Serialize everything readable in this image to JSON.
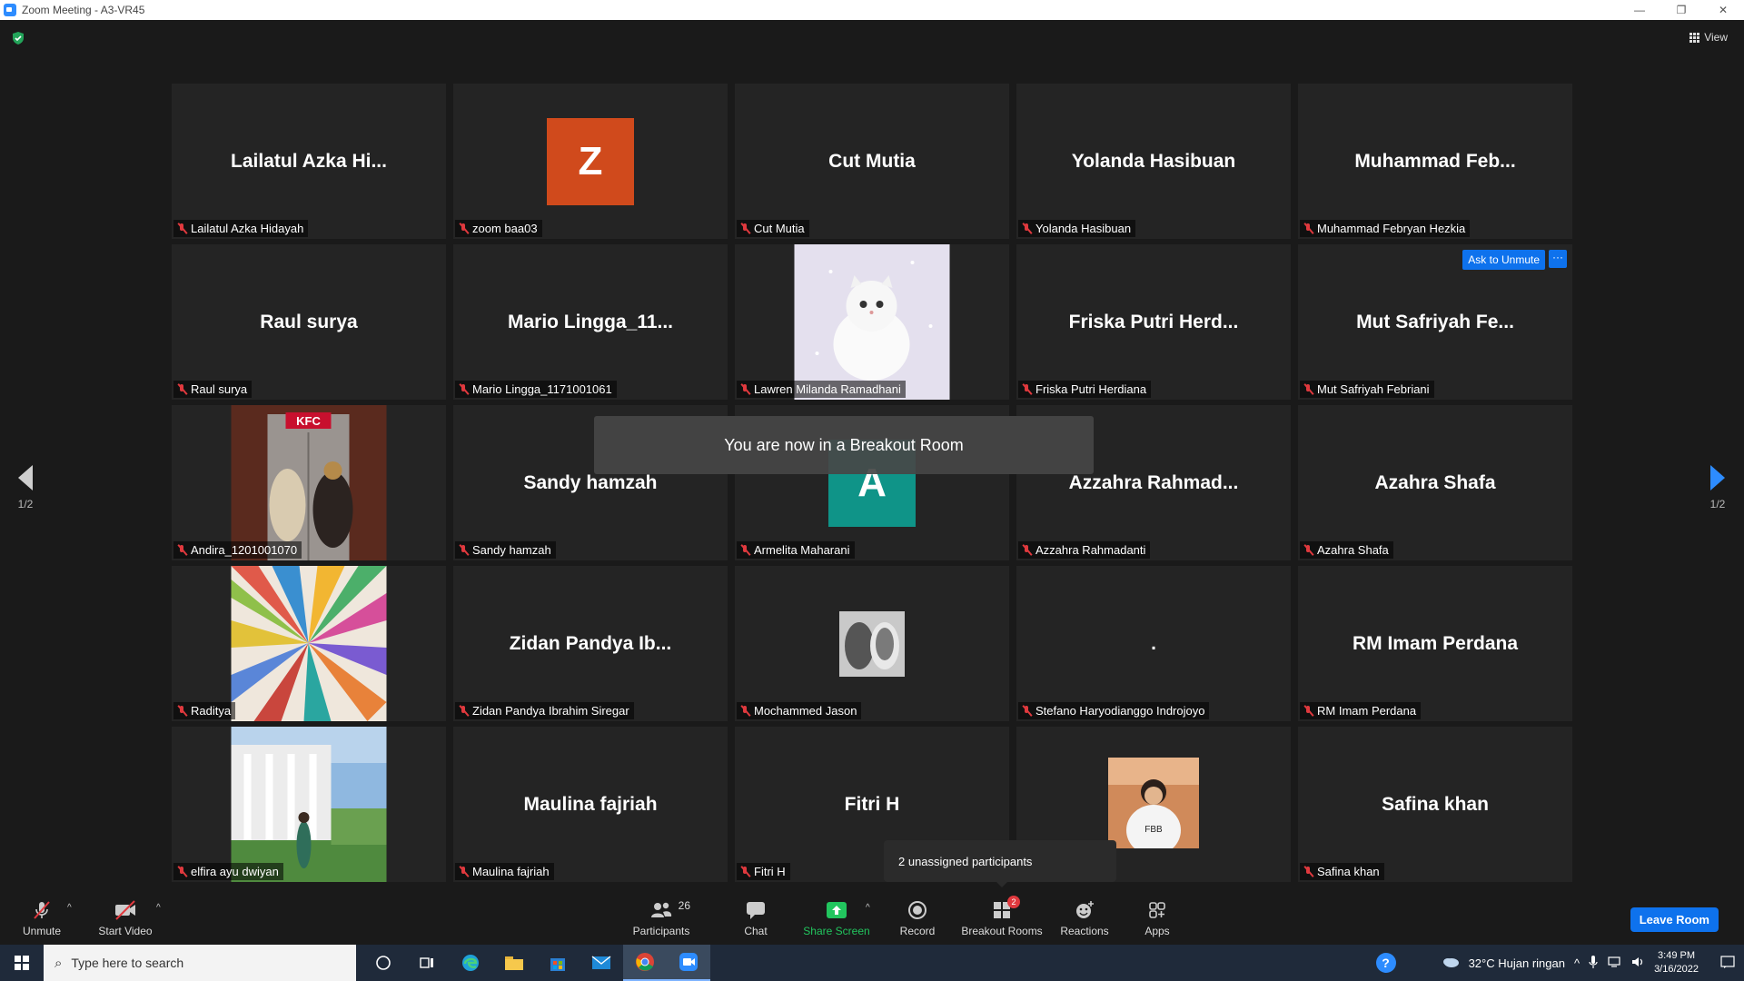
{
  "window": {
    "title": "Zoom Meeting - A3-VR45"
  },
  "header": {
    "view_label": "View"
  },
  "tiles": [
    {
      "name": "Lailatul Azka Hidayah",
      "display": "Lailatul Azka Hi..."
    },
    {
      "name": "zoom baa03",
      "avatar_letter": "Z",
      "avatar_color": "#d04a1c"
    },
    {
      "name": "Cut Mutia",
      "display": "Cut Mutia"
    },
    {
      "name": "Yolanda Hasibuan",
      "display": "Yolanda Hasibuan"
    },
    {
      "name": "Muhammad Febryan Hezkia",
      "display": "Muhammad  Feb..."
    },
    {
      "name": "Raul surya",
      "display": "Raul surya"
    },
    {
      "name": "Mario Lingga_1171001061",
      "display": "Mario  Lingga_11..."
    },
    {
      "name": "Lawren Milanda Ramadhani",
      "photo": "white-cat"
    },
    {
      "name": "Friska Putri Herdiana",
      "display": "Friska Putri Herd..."
    },
    {
      "name": "Mut Safriyah Febriani",
      "display": "Mut Safriyah Fe..."
    },
    {
      "name": "Andira_1201001070",
      "photo": "kfc-elevator"
    },
    {
      "name": "Sandy hamzah",
      "display": "Sandy hamzah"
    },
    {
      "name": "Armelita Maharani",
      "avatar_letter": "A",
      "avatar_color": "#0f9488"
    },
    {
      "name": "Azzahra Rahmadanti",
      "display": "Azzahra  Rahmad..."
    },
    {
      "name": "Azahra Shafa",
      "display": "Azahra Shafa"
    },
    {
      "name": "Raditya",
      "photo": "colorful-rays"
    },
    {
      "name": "Zidan Pandya Ibrahim Siregar",
      "display": "Zidan Pandya Ib..."
    },
    {
      "name": "Mochammed Jason",
      "photo": "small-cars"
    },
    {
      "name": "Stefano Haryodianggo Indrojoyo",
      "display": "."
    },
    {
      "name": "RM Imam Perdana",
      "display": "RM Imam Perdana"
    },
    {
      "name": "elfira ayu dwiyan",
      "photo": "palace-garden"
    },
    {
      "name": "Maulina fajriah",
      "display": "Maulina fajriah"
    },
    {
      "name": "Fitri H",
      "display": "Fitri H"
    },
    {
      "name": "",
      "photo": "girl-portrait"
    },
    {
      "name": "Safina khan",
      "display": "Safina khan"
    }
  ],
  "hover_controls": {
    "ask_to_unmute": "Ask to Unmute",
    "more": "···"
  },
  "pagination": {
    "left": "1/2",
    "right": "1/2"
  },
  "toast": "You are now in a Breakout Room",
  "popup": "2 unassigned participants",
  "toolbar": {
    "unmute": "Unmute",
    "start_video": "Start Video",
    "participants": "Participants",
    "participants_count": "26",
    "chat": "Chat",
    "share_screen": "Share Screen",
    "record": "Record",
    "breakout_rooms": "Breakout Rooms",
    "breakout_badge": "2",
    "reactions": "Reactions",
    "apps": "Apps",
    "leave_room": "Leave Room"
  },
  "taskbar": {
    "search_placeholder": "Type here to search",
    "weather": "32°C  Hujan ringan",
    "time": "3:49 PM",
    "date": "3/16/2022"
  },
  "colors": {
    "accent": "#0e72ed",
    "muted_red": "#e0393e",
    "share_green": "#22c55e"
  }
}
